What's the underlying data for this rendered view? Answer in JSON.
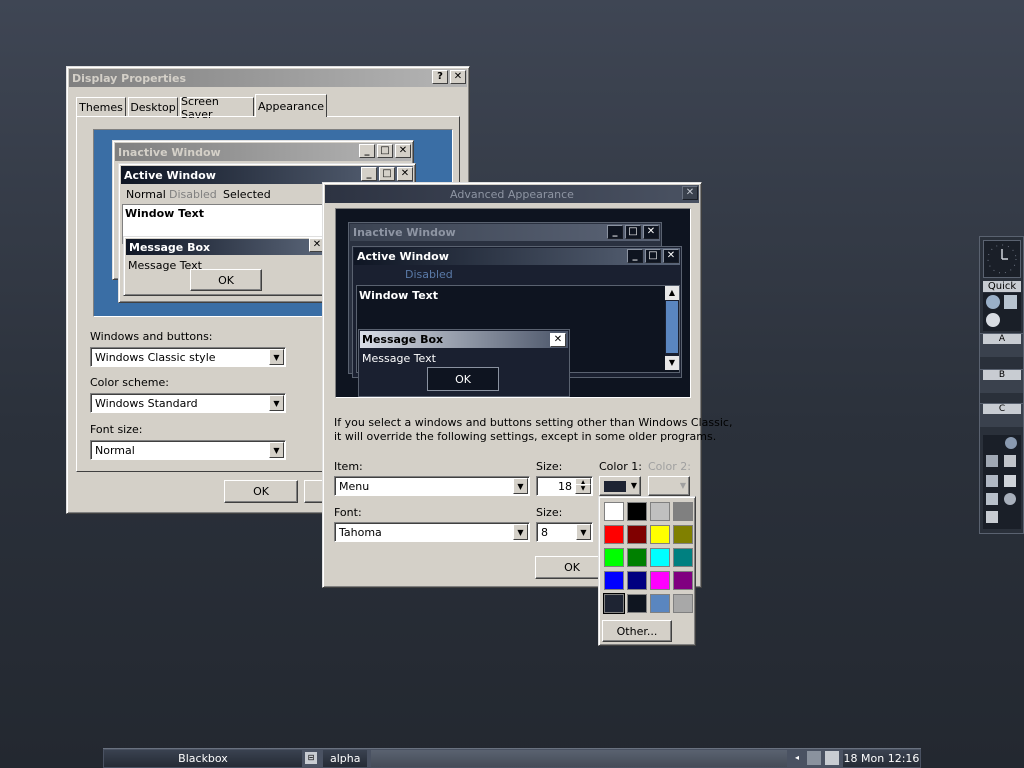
{
  "display_properties": {
    "title": "Display Properties",
    "tabs": [
      "Themes",
      "Desktop",
      "Screen Saver",
      "Appearance"
    ],
    "preview": {
      "inactive_title": "Inactive Window",
      "active_title": "Active Window",
      "menu_items": [
        "Normal",
        "Disabled",
        "Selected"
      ],
      "window_text": "Window Text",
      "msgbox_title": "Message Box",
      "msgbox_text": "Message Text",
      "ok": "OK"
    },
    "windows_buttons_label": "Windows and buttons:",
    "windows_buttons_value": "Windows Classic style",
    "color_scheme_label": "Color scheme:",
    "color_scheme_value": "Windows Standard",
    "font_size_label": "Font size:",
    "font_size_value": "Normal",
    "ok": "OK"
  },
  "advanced": {
    "title": "Advanced Appearance",
    "preview": {
      "inactive_title": "Inactive Window",
      "active_title": "Active Window",
      "disabled": "Disabled",
      "window_text": "Window Text",
      "msgbox_title": "Message Box",
      "msgbox_text": "Message Text",
      "ok": "OK"
    },
    "info_line1": "If you select a windows and buttons setting other than Windows Classic,",
    "info_line2": "it will override the following settings, except in some older programs.",
    "item_label": "Item:",
    "item_value": "Menu",
    "size_label": "Size:",
    "size_value": "18",
    "color1_label": "Color 1:",
    "color2_label": "Color 2:",
    "font_label": "Font:",
    "font_value": "Tahoma",
    "font_size_label": "Size:",
    "font_size_value": "8",
    "ok": "OK"
  },
  "color_picker": {
    "colors": [
      "#ffffff",
      "#000000",
      "#c0c0c0",
      "#808080",
      "#ff0000",
      "#800000",
      "#ffff00",
      "#808000",
      "#00ff00",
      "#008000",
      "#00ffff",
      "#008080",
      "#0000ff",
      "#000080",
      "#ff00ff",
      "#800080",
      "#1e2433",
      "#0f1520",
      "#5a86c0",
      "#a8a8a8"
    ],
    "other_button": "Other..."
  },
  "slit": {
    "workspaces": [
      "A",
      "B",
      "C"
    ],
    "quick_label": "Quick"
  },
  "taskbar": {
    "workspace_name": "Blackbox",
    "task": "alpha",
    "clock": "18 Mon 12:16"
  }
}
